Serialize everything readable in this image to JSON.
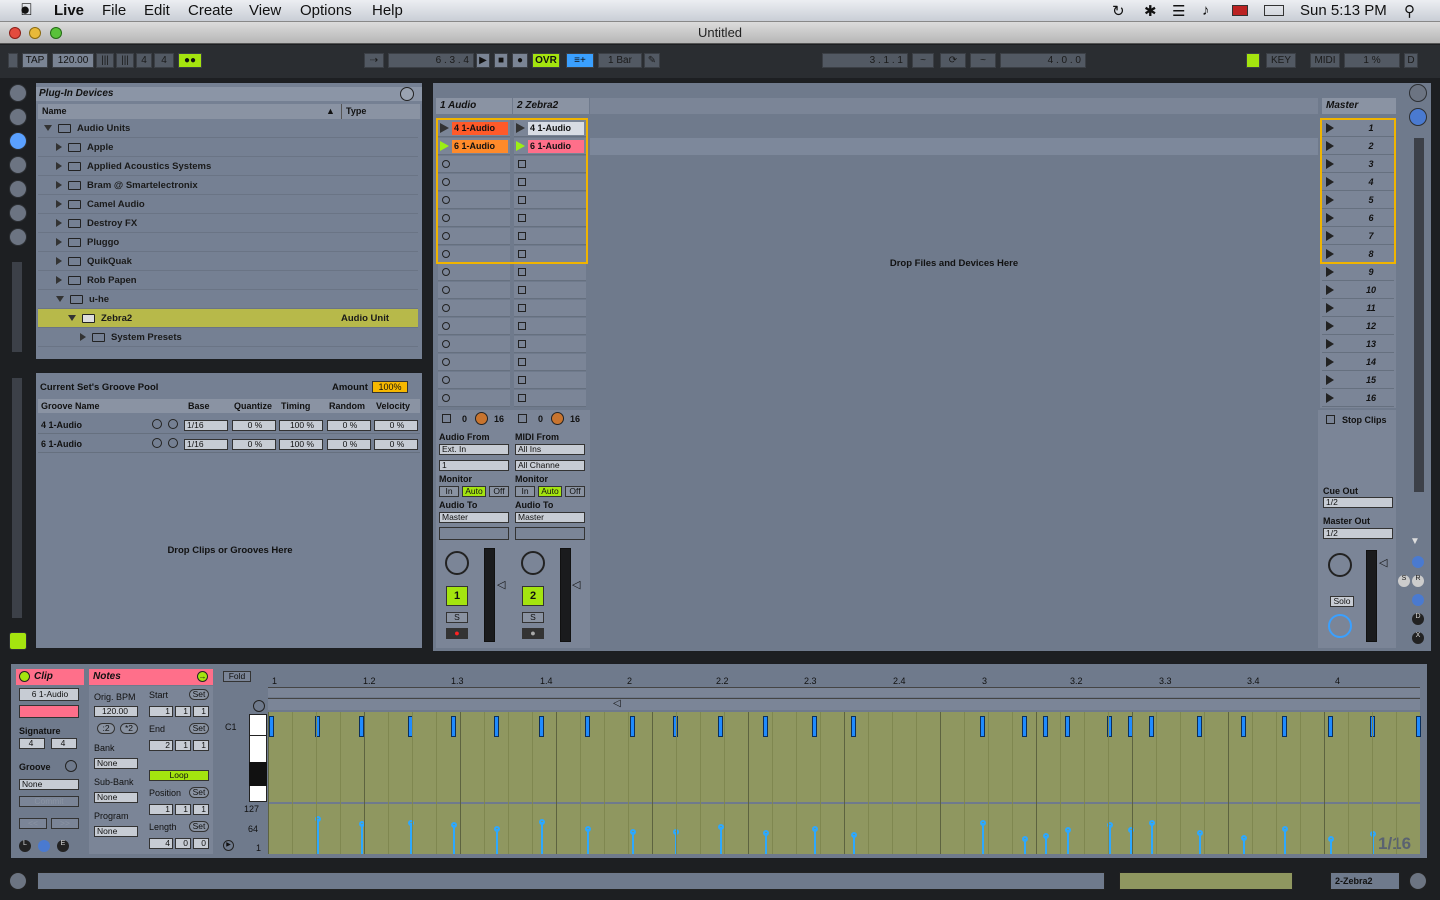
{
  "menubar": {
    "app": "Live",
    "items": [
      "File",
      "Edit",
      "Create",
      "View",
      "Options",
      "Help"
    ],
    "clock": "Sun 5:13 PM"
  },
  "window": {
    "title": "Untitled"
  },
  "transport": {
    "tap": "TAP",
    "bpm": "120.00",
    "signature_num": "4",
    "signature_den": "4",
    "position": "6 .  3 .  4",
    "ovr": "OVR",
    "quantize": "1 Bar",
    "loop_start": "3 .  1 .  1",
    "loop_length": "4 .  0 .  0",
    "key": "KEY",
    "midi": "MIDI",
    "cpu": "1 %",
    "d": "D"
  },
  "browser": {
    "title": "Plug-In Devices",
    "col_name": "Name",
    "col_type": "Type",
    "items": [
      {
        "label": "Audio Units",
        "type": ""
      },
      {
        "label": "Apple",
        "type": ""
      },
      {
        "label": "Applied Acoustics Systems",
        "type": ""
      },
      {
        "label": "Bram @ Smartelectronix",
        "type": ""
      },
      {
        "label": "Camel Audio",
        "type": ""
      },
      {
        "label": "Destroy FX",
        "type": ""
      },
      {
        "label": "Pluggo",
        "type": ""
      },
      {
        "label": "QuikQuak",
        "type": ""
      },
      {
        "label": "Rob Papen",
        "type": ""
      },
      {
        "label": "u-he",
        "type": ""
      },
      {
        "label": "Zebra2",
        "type": "Audio Unit"
      },
      {
        "label": "System Presets",
        "type": ""
      }
    ]
  },
  "groove": {
    "title": "Current Set's Groove Pool",
    "amount_label": "Amount",
    "amount": "100%",
    "headers": [
      "Groove Name",
      "Base",
      "Quantize",
      "Timing",
      "Random",
      "Velocity"
    ],
    "rows": [
      {
        "name": "4 1-Audio",
        "base": "1/16",
        "quantize": "0 %",
        "timing": "100 %",
        "random": "0 %",
        "velocity": "0 %"
      },
      {
        "name": "6 1-Audio",
        "base": "1/16",
        "quantize": "0 %",
        "timing": "100 %",
        "random": "0 %",
        "velocity": "0 %"
      }
    ],
    "drop": "Drop Clips or Grooves Here"
  },
  "session": {
    "tracks": [
      {
        "name": "1 Audio",
        "clips": [
          "4 1-Audio",
          "6 1-Audio"
        ],
        "from_label": "Audio From",
        "from": "Ext. In",
        "from_ch": "1",
        "to_label": "Audio To",
        "to": "Master",
        "number": "1",
        "sends": "0",
        "send_max": "16"
      },
      {
        "name": "2 Zebra2",
        "clips": [
          "4 1-Audio",
          "6 1-Audio"
        ],
        "from_label": "MIDI From",
        "from": "All Ins",
        "from_ch": "All Channe",
        "to_label": "Audio To",
        "to": "Master",
        "number": "2",
        "sends": "0",
        "send_max": "16"
      }
    ],
    "monitor_label": "Monitor",
    "monitor": [
      "In",
      "Auto",
      "Off"
    ],
    "master": "Master",
    "scenes": [
      "1",
      "2",
      "3",
      "4",
      "5",
      "6",
      "7",
      "8",
      "9",
      "10",
      "11",
      "12",
      "13",
      "14",
      "15",
      "16"
    ],
    "drop": "Drop Files and Devices Here",
    "stop_clips": "Stop Clips",
    "cue_out_label": "Cue Out",
    "cue_out": "1/2",
    "master_out_label": "Master Out",
    "master_out": "1/2",
    "solo": "Solo",
    "s": "S"
  },
  "clipview": {
    "clip_label": "Clip",
    "clip_name": "6 1-Audio",
    "signature_label": "Signature",
    "sig_num": "4",
    "sig_den": "4",
    "groove_label": "Groove",
    "groove": "None",
    "commit": "Commit",
    "notes_label": "Notes",
    "orig_bpm_label": "Orig. BPM",
    "orig_bpm": "120.00",
    "half": ":2",
    "double": "*2",
    "bank_label": "Bank",
    "bank": "None",
    "subbank_label": "Sub-Bank",
    "subbank": "None",
    "program_label": "Program",
    "program": "None",
    "start_label": "Start",
    "end_label": "End",
    "loop": "Loop",
    "position_label": "Position",
    "length_label": "Length",
    "set": "Set",
    "start": [
      "1",
      "1",
      "1"
    ],
    "end": [
      "2",
      "1",
      "1"
    ],
    "position": [
      "1",
      "1",
      "1"
    ],
    "length": [
      "4",
      "0",
      "0"
    ],
    "fold": "Fold",
    "c1": "C1",
    "vel_127": "127",
    "vel_64": "64",
    "vel_1": "1",
    "grid": "1/16",
    "ruler": [
      "1",
      "1.2",
      "1.3",
      "1.4",
      "2",
      "2.2",
      "2.3",
      "2.4",
      "3",
      "3.2",
      "3.3",
      "3.4",
      "4"
    ]
  },
  "status": {
    "track": "2-Zebra2"
  },
  "colors": {
    "accent_green": "#a4e40f",
    "clip_orange": "#ff7a2a",
    "clip_pink": "#ff6f8a",
    "note_blue": "#1f8bff",
    "selection": "#f0b400"
  }
}
